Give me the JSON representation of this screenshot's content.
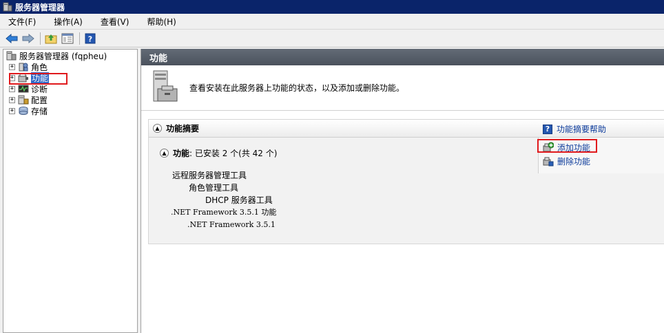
{
  "window": {
    "title": "服务器管理器"
  },
  "menu": [
    "文件(F)",
    "操作(A)",
    "查看(V)",
    "帮助(H)"
  ],
  "toolbar": {
    "icons": [
      "back-arrow-icon",
      "forward-arrow-icon",
      "up-folder-icon",
      "show-hide-tree-icon",
      "help-icon"
    ]
  },
  "tree": {
    "root": "服务器管理器 (fqpheu)",
    "items": [
      {
        "label": "角色",
        "icon": "roles-icon"
      },
      {
        "label": "功能",
        "icon": "features-icon",
        "selected": true
      },
      {
        "label": "诊断",
        "icon": "diagnostics-icon"
      },
      {
        "label": "配置",
        "icon": "configuration-icon"
      },
      {
        "label": "存储",
        "icon": "storage-icon"
      }
    ],
    "expander": "+"
  },
  "pane": {
    "header": "功能",
    "description": "查看安装在此服务器上功能的状态，以及添加或删除功能。",
    "section": {
      "title": "功能摘要",
      "help_link": "功能摘要帮助",
      "summary_label": "功能",
      "summary_value": ": 已安装 2 个(共 42 个)",
      "features": [
        {
          "text": "远程服务器管理工具",
          "level": 0
        },
        {
          "text": "角色管理工具",
          "level": 1
        },
        {
          "text": "DHCP 服务器工具",
          "level": 2
        },
        {
          "text": ".NET Framework 3.5.1 功能",
          "level": 0
        },
        {
          "text": ".NET Framework 3.5.1",
          "level": 1
        }
      ],
      "actions": [
        {
          "label": "添加功能",
          "icon": "add-feature-icon"
        },
        {
          "label": "删除功能",
          "icon": "remove-feature-icon"
        }
      ]
    }
  },
  "colors": {
    "titlebar": "#0a246a",
    "header": "#555c67",
    "link": "#0b3a9a",
    "highlight": "#e0191c"
  }
}
